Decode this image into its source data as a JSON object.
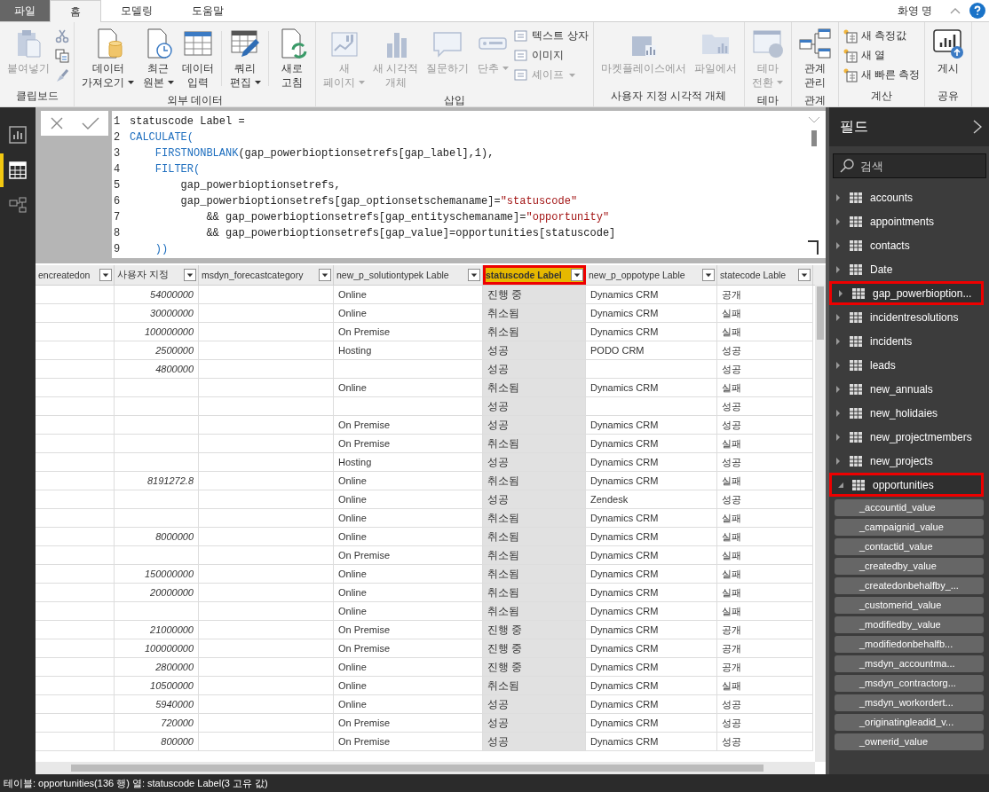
{
  "menu_tabs": [
    {
      "label": "파일",
      "kind": "file",
      "selected": false
    },
    {
      "label": "홈",
      "kind": "tab",
      "selected": true
    },
    {
      "label": "모델링",
      "kind": "tab",
      "selected": false
    },
    {
      "label": "도움말",
      "kind": "tab",
      "selected": false
    }
  ],
  "user": "화영 명",
  "ribbon": [
    {
      "label": "클립보드",
      "items": [
        {
          "kind": "large",
          "lines": [
            "붙여넣기"
          ],
          "disabled": true,
          "dropdown": false
        },
        {
          "kind": "tools"
        }
      ]
    },
    {
      "label": "외부 데이터",
      "items": [
        {
          "kind": "large",
          "lines": [
            "데이터",
            "가져오기"
          ],
          "disabled": false,
          "dropdown": true
        },
        {
          "kind": "large",
          "lines": [
            "최근",
            "원본"
          ],
          "disabled": false,
          "dropdown": true
        },
        {
          "kind": "large",
          "lines": [
            "데이터",
            "입력"
          ],
          "disabled": false,
          "dropdown": false
        },
        {
          "kind": "large",
          "lines": [
            "쿼리",
            "편집"
          ],
          "disabled": false,
          "dropdown": true
        },
        {
          "kind": "large",
          "lines": [
            "새로",
            "고침"
          ],
          "disabled": false,
          "dropdown": false
        }
      ]
    },
    {
      "label": "삽입",
      "items": [
        {
          "kind": "large",
          "lines": [
            "새",
            "페이지"
          ],
          "disabled": true,
          "dropdown": true
        },
        {
          "kind": "large",
          "lines": [
            "새 시각적",
            "개체"
          ],
          "disabled": true,
          "dropdown": false
        },
        {
          "kind": "large",
          "lines": [
            "질문하기"
          ],
          "disabled": true,
          "dropdown": false
        },
        {
          "kind": "large",
          "lines": [
            "단추"
          ],
          "disabled": true,
          "dropdown": true
        },
        {
          "kind": "small",
          "entries": [
            {
              "label": "텍스트 상자",
              "disabled": false,
              "dropdown": false
            },
            {
              "label": "이미지",
              "disabled": false,
              "dropdown": false
            },
            {
              "label": "셰이프",
              "disabled": true,
              "dropdown": true
            }
          ]
        }
      ]
    },
    {
      "label": "사용자 지정 시각적 개체",
      "items": [
        {
          "kind": "large",
          "lines": [
            "마켓플레이스에서"
          ],
          "disabled": true,
          "dropdown": false
        },
        {
          "kind": "large",
          "lines": [
            "파일에서"
          ],
          "disabled": true,
          "dropdown": false
        }
      ]
    },
    {
      "label": "테마",
      "items": [
        {
          "kind": "large",
          "lines": [
            "테마",
            "전환"
          ],
          "disabled": true,
          "dropdown": true
        }
      ]
    },
    {
      "label": "관계",
      "items": [
        {
          "kind": "large",
          "lines": [
            "관계",
            "관리"
          ],
          "disabled": false,
          "dropdown": false
        }
      ]
    },
    {
      "label": "계산",
      "items": [
        {
          "kind": "small",
          "entries": [
            {
              "label": "새 측정값",
              "disabled": false,
              "dropdown": false
            },
            {
              "label": "새 열",
              "disabled": false,
              "dropdown": false
            },
            {
              "label": "새 빠른 측정",
              "disabled": false,
              "dropdown": false
            }
          ]
        }
      ]
    },
    {
      "label": "공유",
      "items": [
        {
          "kind": "large",
          "lines": [
            "게시"
          ],
          "disabled": false,
          "dropdown": false
        }
      ]
    }
  ],
  "nav": [
    {
      "selected": false
    },
    {
      "selected": true
    },
    {
      "selected": false
    }
  ],
  "formula": {
    "lines": [
      {
        "no": "1",
        "tokens": [
          {
            "kind": "plain",
            "text": "statuscode Label ="
          }
        ]
      },
      {
        "no": "2",
        "tokens": [
          {
            "kind": "fn",
            "text": "CALCULATE("
          }
        ]
      },
      {
        "no": "3",
        "tokens": [
          {
            "kind": "fn",
            "text": "    FIRSTNONBLANK"
          },
          {
            "kind": "plain",
            "text": "(gap_powerbioptionsetrefs[gap_label],1),"
          }
        ]
      },
      {
        "no": "4",
        "tokens": [
          {
            "kind": "fn",
            "text": "    FILTER("
          }
        ]
      },
      {
        "no": "5",
        "tokens": [
          {
            "kind": "plain",
            "text": "        gap_powerbioptionsetrefs,"
          }
        ]
      },
      {
        "no": "6",
        "tokens": [
          {
            "kind": "plain",
            "text": "        gap_powerbioptionsetrefs[gap_optionsetschemaname]="
          },
          {
            "kind": "str",
            "text": "\"statuscode\""
          }
        ]
      },
      {
        "no": "7",
        "tokens": [
          {
            "kind": "plain",
            "text": "            && gap_powerbioptionsetrefs[gap_entityschemaname]="
          },
          {
            "kind": "str",
            "text": "\"opportunity\""
          }
        ]
      },
      {
        "no": "8",
        "tokens": [
          {
            "kind": "plain",
            "text": "            && gap_powerbioptionsetrefs[gap_value]=opportunities[statuscode]"
          }
        ]
      },
      {
        "no": "9",
        "tokens": [
          {
            "kind": "fn",
            "text": "    ))"
          }
        ]
      }
    ]
  },
  "table": {
    "columns": [
      {
        "label": "encreatedon",
        "selected": false,
        "highlighted": false
      },
      {
        "label": "사용자 지정",
        "selected": false,
        "highlighted": false
      },
      {
        "label": "msdyn_forecastcategory",
        "selected": false,
        "highlighted": false
      },
      {
        "label": "new_p_solutiontypek Lable",
        "selected": false,
        "highlighted": false
      },
      {
        "label": "statuscode Label",
        "selected": true,
        "highlighted": true
      },
      {
        "label": "new_p_oppotype Lable",
        "selected": false,
        "highlighted": false
      },
      {
        "label": "statecode Lable",
        "selected": false,
        "highlighted": false
      }
    ],
    "rows": [
      [
        null,
        "54000000",
        null,
        "Online",
        "진행 중",
        "Dynamics CRM",
        "공개"
      ],
      [
        null,
        "30000000",
        null,
        "Online",
        "취소됨",
        "Dynamics CRM",
        "실패"
      ],
      [
        null,
        "100000000",
        null,
        "On Premise",
        "취소됨",
        "Dynamics CRM",
        "실패"
      ],
      [
        null,
        "2500000",
        null,
        "Hosting",
        "성공",
        "PODO CRM",
        "성공"
      ],
      [
        null,
        "4800000",
        null,
        null,
        "성공",
        null,
        "성공"
      ],
      [
        null,
        null,
        null,
        "Online",
        "취소됨",
        "Dynamics CRM",
        "실패"
      ],
      [
        null,
        null,
        null,
        null,
        "성공",
        null,
        "성공"
      ],
      [
        null,
        null,
        null,
        "On Premise",
        "성공",
        "Dynamics CRM",
        "성공"
      ],
      [
        null,
        null,
        null,
        "On Premise",
        "취소됨",
        "Dynamics CRM",
        "실패"
      ],
      [
        null,
        null,
        null,
        "Hosting",
        "성공",
        "Dynamics CRM",
        "성공"
      ],
      [
        null,
        "8191272.8",
        null,
        "Online",
        "취소됨",
        "Dynamics CRM",
        "실패"
      ],
      [
        null,
        null,
        null,
        "Online",
        "성공",
        "Zendesk",
        "성공"
      ],
      [
        null,
        null,
        null,
        "Online",
        "취소됨",
        "Dynamics CRM",
        "실패"
      ],
      [
        null,
        "8000000",
        null,
        "Online",
        "취소됨",
        "Dynamics CRM",
        "실패"
      ],
      [
        null,
        null,
        null,
        "On Premise",
        "취소됨",
        "Dynamics CRM",
        "실패"
      ],
      [
        null,
        "150000000",
        null,
        "Online",
        "취소됨",
        "Dynamics CRM",
        "실패"
      ],
      [
        null,
        "20000000",
        null,
        "Online",
        "취소됨",
        "Dynamics CRM",
        "실패"
      ],
      [
        null,
        null,
        null,
        "Online",
        "취소됨",
        "Dynamics CRM",
        "실패"
      ],
      [
        null,
        "21000000",
        null,
        "On Premise",
        "진행 중",
        "Dynamics CRM",
        "공개"
      ],
      [
        null,
        "100000000",
        null,
        "On Premise",
        "진행 중",
        "Dynamics CRM",
        "공개"
      ],
      [
        null,
        "2800000",
        null,
        "Online",
        "진행 중",
        "Dynamics CRM",
        "공개"
      ],
      [
        null,
        "10500000",
        null,
        "Online",
        "취소됨",
        "Dynamics CRM",
        "실패"
      ],
      [
        null,
        "5940000",
        null,
        "Online",
        "성공",
        "Dynamics CRM",
        "성공"
      ],
      [
        null,
        "720000",
        null,
        "On Premise",
        "성공",
        "Dynamics CRM",
        "성공"
      ],
      [
        null,
        "800000",
        null,
        "On Premise",
        "성공",
        "Dynamics CRM",
        "성공"
      ]
    ]
  },
  "fields": {
    "title": "필드",
    "search": {
      "placeholder": "검색"
    },
    "tables": [
      {
        "name": "accounts",
        "expanded": false,
        "highlighted": false
      },
      {
        "name": "appointments",
        "expanded": false,
        "highlighted": false
      },
      {
        "name": "contacts",
        "expanded": false,
        "highlighted": false
      },
      {
        "name": "Date",
        "expanded": false,
        "highlighted": false
      },
      {
        "name": "gap_powerbioption...",
        "expanded": false,
        "highlighted": true
      },
      {
        "name": "incidentresolutions",
        "expanded": false,
        "highlighted": false
      },
      {
        "name": "incidents",
        "expanded": false,
        "highlighted": false
      },
      {
        "name": "leads",
        "expanded": false,
        "highlighted": false
      },
      {
        "name": "new_annuals",
        "expanded": false,
        "highlighted": false
      },
      {
        "name": "new_holidaies",
        "expanded": false,
        "highlighted": false
      },
      {
        "name": "new_projectmembers",
        "expanded": false,
        "highlighted": false
      },
      {
        "name": "new_projects",
        "expanded": false,
        "highlighted": false
      },
      {
        "name": "opportunities",
        "expanded": true,
        "highlighted": true,
        "children": [
          "_accountid_value",
          "_campaignid_value",
          "_contactid_value",
          "_createdby_value",
          "_createdonbehalfby_...",
          "_customerid_value",
          "_modifiedby_value",
          "_modifiedonbehalfb...",
          "_msdyn_accountma...",
          "_msdyn_contractorg...",
          "_msdyn_workordert...",
          "_originatingleadid_v...",
          "_ownerid_value"
        ]
      }
    ]
  },
  "status_bar": "테이블: opportunities(136 행) 열: statuscode Label(3 고유 값)"
}
